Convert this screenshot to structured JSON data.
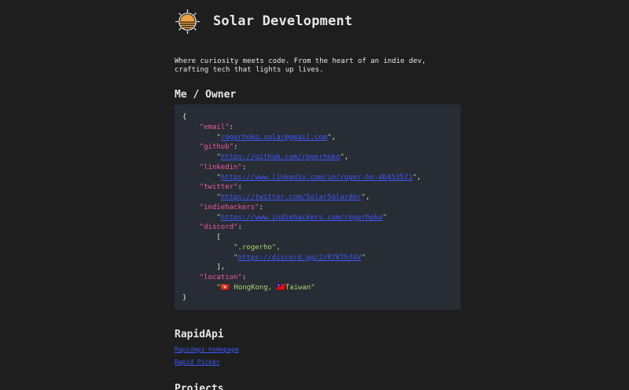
{
  "header": {
    "title": "Solar Development",
    "logo_icon": "sun-logo-icon"
  },
  "intro": "Where curiosity meets code. From the heart of an indie dev, crafting tech that lights up lives.",
  "owner_section": {
    "title": "Me / Owner",
    "code": {
      "open_brace": "{",
      "close_brace": "}",
      "email_key": "\"email\"",
      "email_value": "rogerhoko.solar@gmail.com",
      "github_key": "\"github\"",
      "github_value": "https://github.com/rogerhoko",
      "linkedin_key": "\"linkedin\"",
      "linkedin_value": "https://www.linkedin.com/in/roger-ho-4b453571",
      "twitter_key": "\"twitter\"",
      "twitter_value": "https://twitter.com/SolarSolarder",
      "indiehackers_key": "\"indiehackers\"",
      "indiehackers_value": "https://www.indiehackers.com/rogerhoko",
      "discord_key": "\"discord\"",
      "discord_open": "[",
      "discord_close": "],",
      "discord_user": "\".rogerho\",",
      "discord_link": "https://discord.gg/2rR7KThfAV",
      "location_key": "\"location\"",
      "location_value": "\"🇭🇰 HongKong, 🇹🇼Taiwan\""
    }
  },
  "rapid_section": {
    "title": "RapidApi",
    "links": [
      "Rapidapi homepage",
      "Rapid Picker"
    ]
  },
  "projects_section": {
    "title": "Projects"
  },
  "colors": {
    "background": "#1e1e1e",
    "code_background": "#282c34",
    "key": "#f15b9c",
    "string": "#a5d86e",
    "link": "#3b5bff",
    "logo_orange": "#f0a040"
  }
}
